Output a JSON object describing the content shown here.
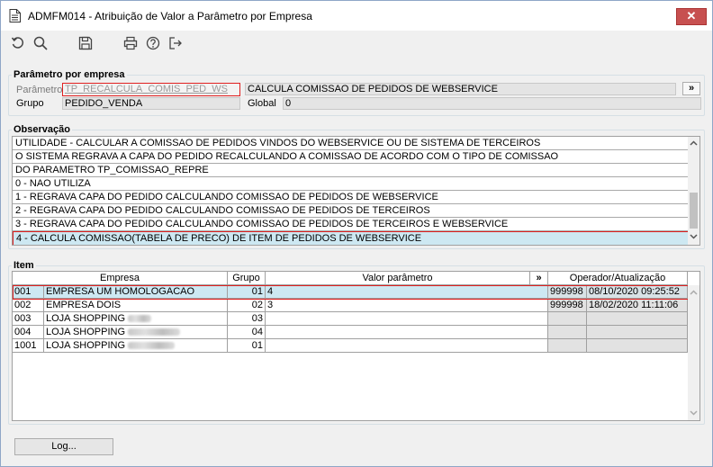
{
  "window": {
    "title": "ADMFM014 - Atribuição de Valor a Parâmetro por Empresa",
    "close_label": "✕"
  },
  "toolbar": {
    "icons": [
      "undo-icon",
      "search-icon",
      "save-icon",
      "print-icon",
      "help-icon",
      "exit-icon"
    ]
  },
  "param": {
    "group_title": "Parâmetro por empresa",
    "parametro_label": "Parâmetro",
    "parametro_value": "TP_RECALCULA_COMIS_PED_WS",
    "descricao_value": "CALCULA COMISSAO DE PEDIDOS DE WEBSERVICE",
    "expand_label": "»",
    "grupo_label": "Grupo",
    "grupo_value": "PEDIDO_VENDA",
    "global_label": "Global",
    "global_value": "0"
  },
  "observacao": {
    "group_title": "Observação",
    "lines": [
      "UTILIDADE - CALCULAR A COMISSAO DE PEDIDOS VINDOS DO WEBSERVICE OU DE SISTEMA DE TERCEIROS",
      "O SISTEMA REGRAVA A CAPA DO PEDIDO RECALCULANDO A COMISSAO DE ACORDO COM O TIPO DE COMISSAO",
      "DO PARAMETRO TP_COMISSAO_REPRE",
      "0 - NAO UTILIZA",
      "1 - REGRAVA CAPA DO PEDIDO CALCULANDO COMISSAO DE PEDIDOS DE WEBSERVICE",
      "2 - REGRAVA CAPA DO PEDIDO CALCULANDO COMISSAO DE PEDIDOS DE TERCEIROS",
      "3 - REGRAVA CAPA DO PEDIDO CALCULANDO COMISSAO DE PEDIDOS DE TERCEIROS E WEBSERVICE",
      "4 - CALCULA COMISSAO(TABELA DE PRECO) DE ITEM DE PEDIDOS DE WEBSERVICE"
    ]
  },
  "item": {
    "group_title": "Item",
    "headers": {
      "empresa": "Empresa",
      "grupo": "Grupo",
      "valor": "Valor parâmetro",
      "expand": "»",
      "operador": "Operador/Atualização"
    },
    "rows": [
      {
        "cod": "001",
        "empresa": "EMPRESA UM HOMOLOGACAO",
        "grupo": "01",
        "valor": "4",
        "operador": "999998",
        "atualizacao": "08/10/2020 09:25:52"
      },
      {
        "cod": "002",
        "empresa": "EMPRESA DOIS",
        "grupo": "02",
        "valor": "3",
        "operador": "999998",
        "atualizacao": "18/02/2020 11:11:06"
      },
      {
        "cod": "003",
        "empresa": "LOJA SHOPPING",
        "grupo": "03",
        "valor": "",
        "operador": "",
        "atualizacao": ""
      },
      {
        "cod": "004",
        "empresa": "LOJA SHOPPING",
        "grupo": "04",
        "valor": "",
        "operador": "",
        "atualizacao": ""
      },
      {
        "cod": "1001",
        "empresa": "LOJA SHOPPING",
        "grupo": "01",
        "valor": "",
        "operador": "",
        "atualizacao": ""
      }
    ]
  },
  "footer": {
    "log_label": "Log..."
  }
}
